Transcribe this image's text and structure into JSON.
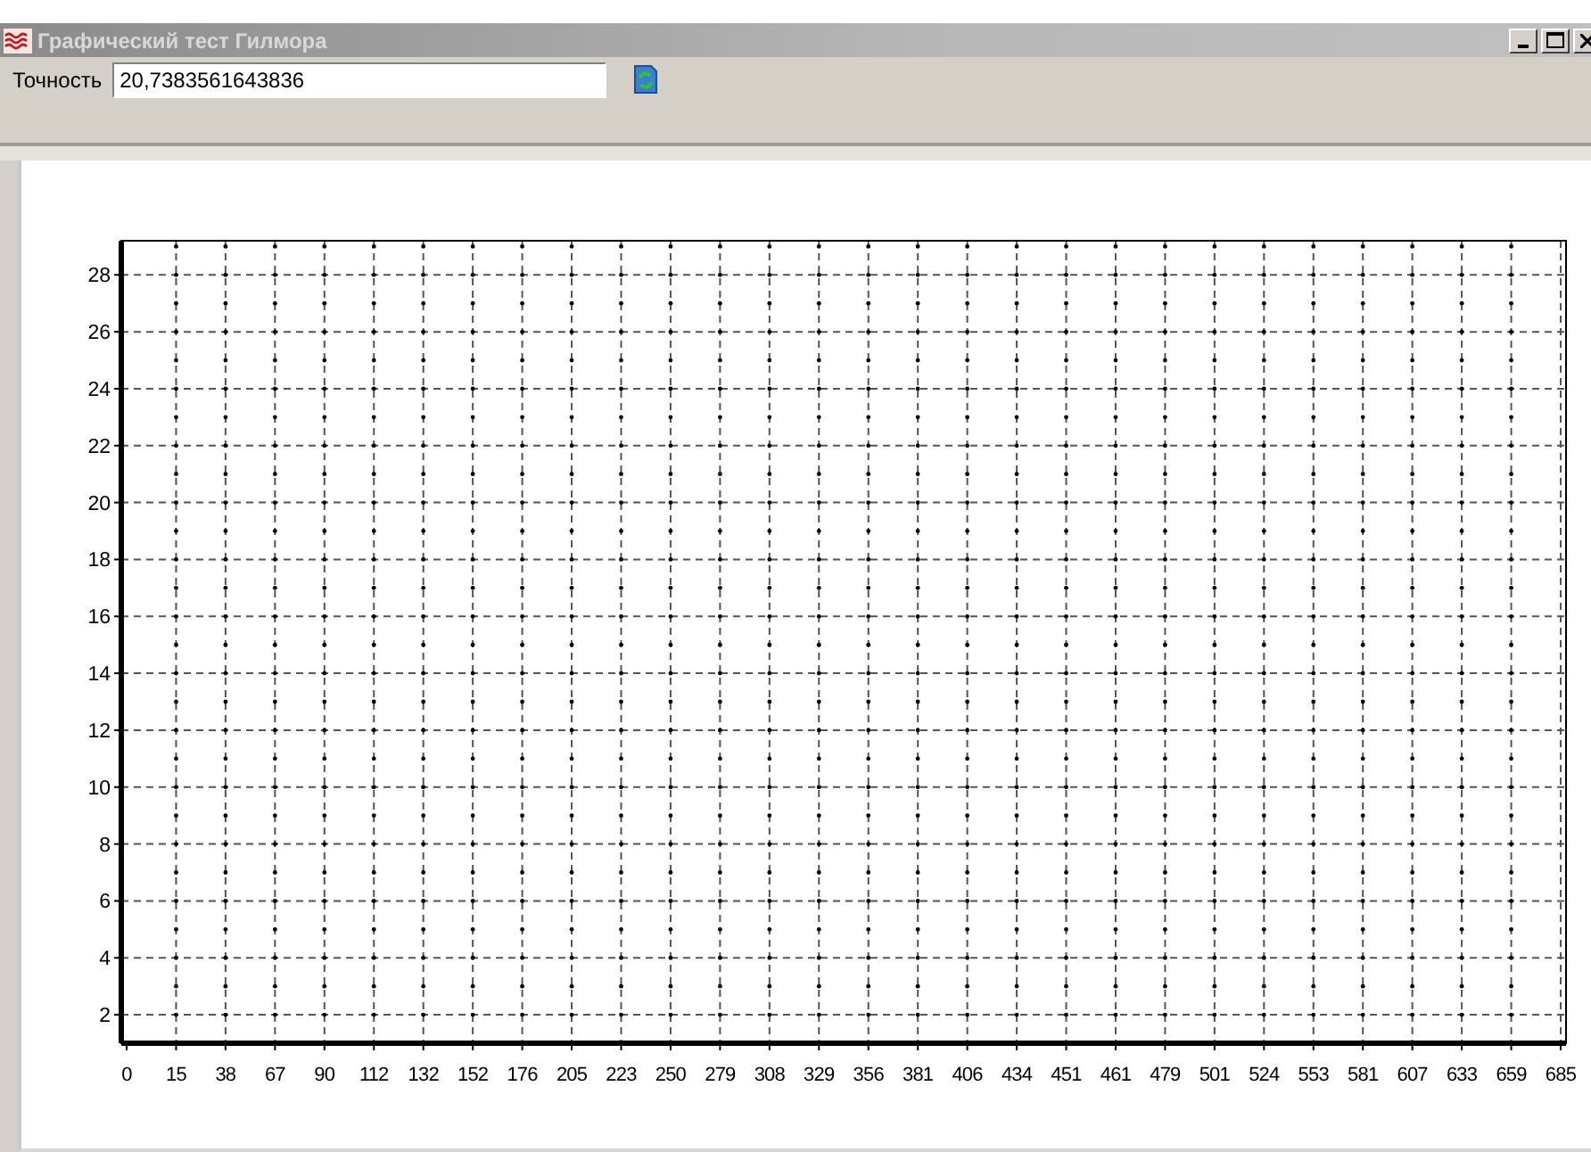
{
  "window": {
    "title": "Графический тест Гилмора"
  },
  "toolbar": {
    "label": "Точность",
    "value": "20,7383561643836"
  },
  "chart": {
    "chart_data": {
      "type": "scatter",
      "categories": [
        "0",
        "15",
        "38",
        "67",
        "90",
        "112",
        "132",
        "152",
        "176",
        "205",
        "223",
        "250",
        "279",
        "308",
        "329",
        "356",
        "381",
        "406",
        "434",
        "451",
        "461",
        "479",
        "501",
        "524",
        "553",
        "581",
        "607",
        "633",
        "659",
        "685"
      ],
      "ylim": [
        1,
        29.2
      ],
      "grid": true,
      "yticks": [
        2,
        4,
        6,
        8,
        10,
        12,
        14,
        16,
        18,
        20,
        22,
        24,
        26,
        28
      ]
    }
  }
}
